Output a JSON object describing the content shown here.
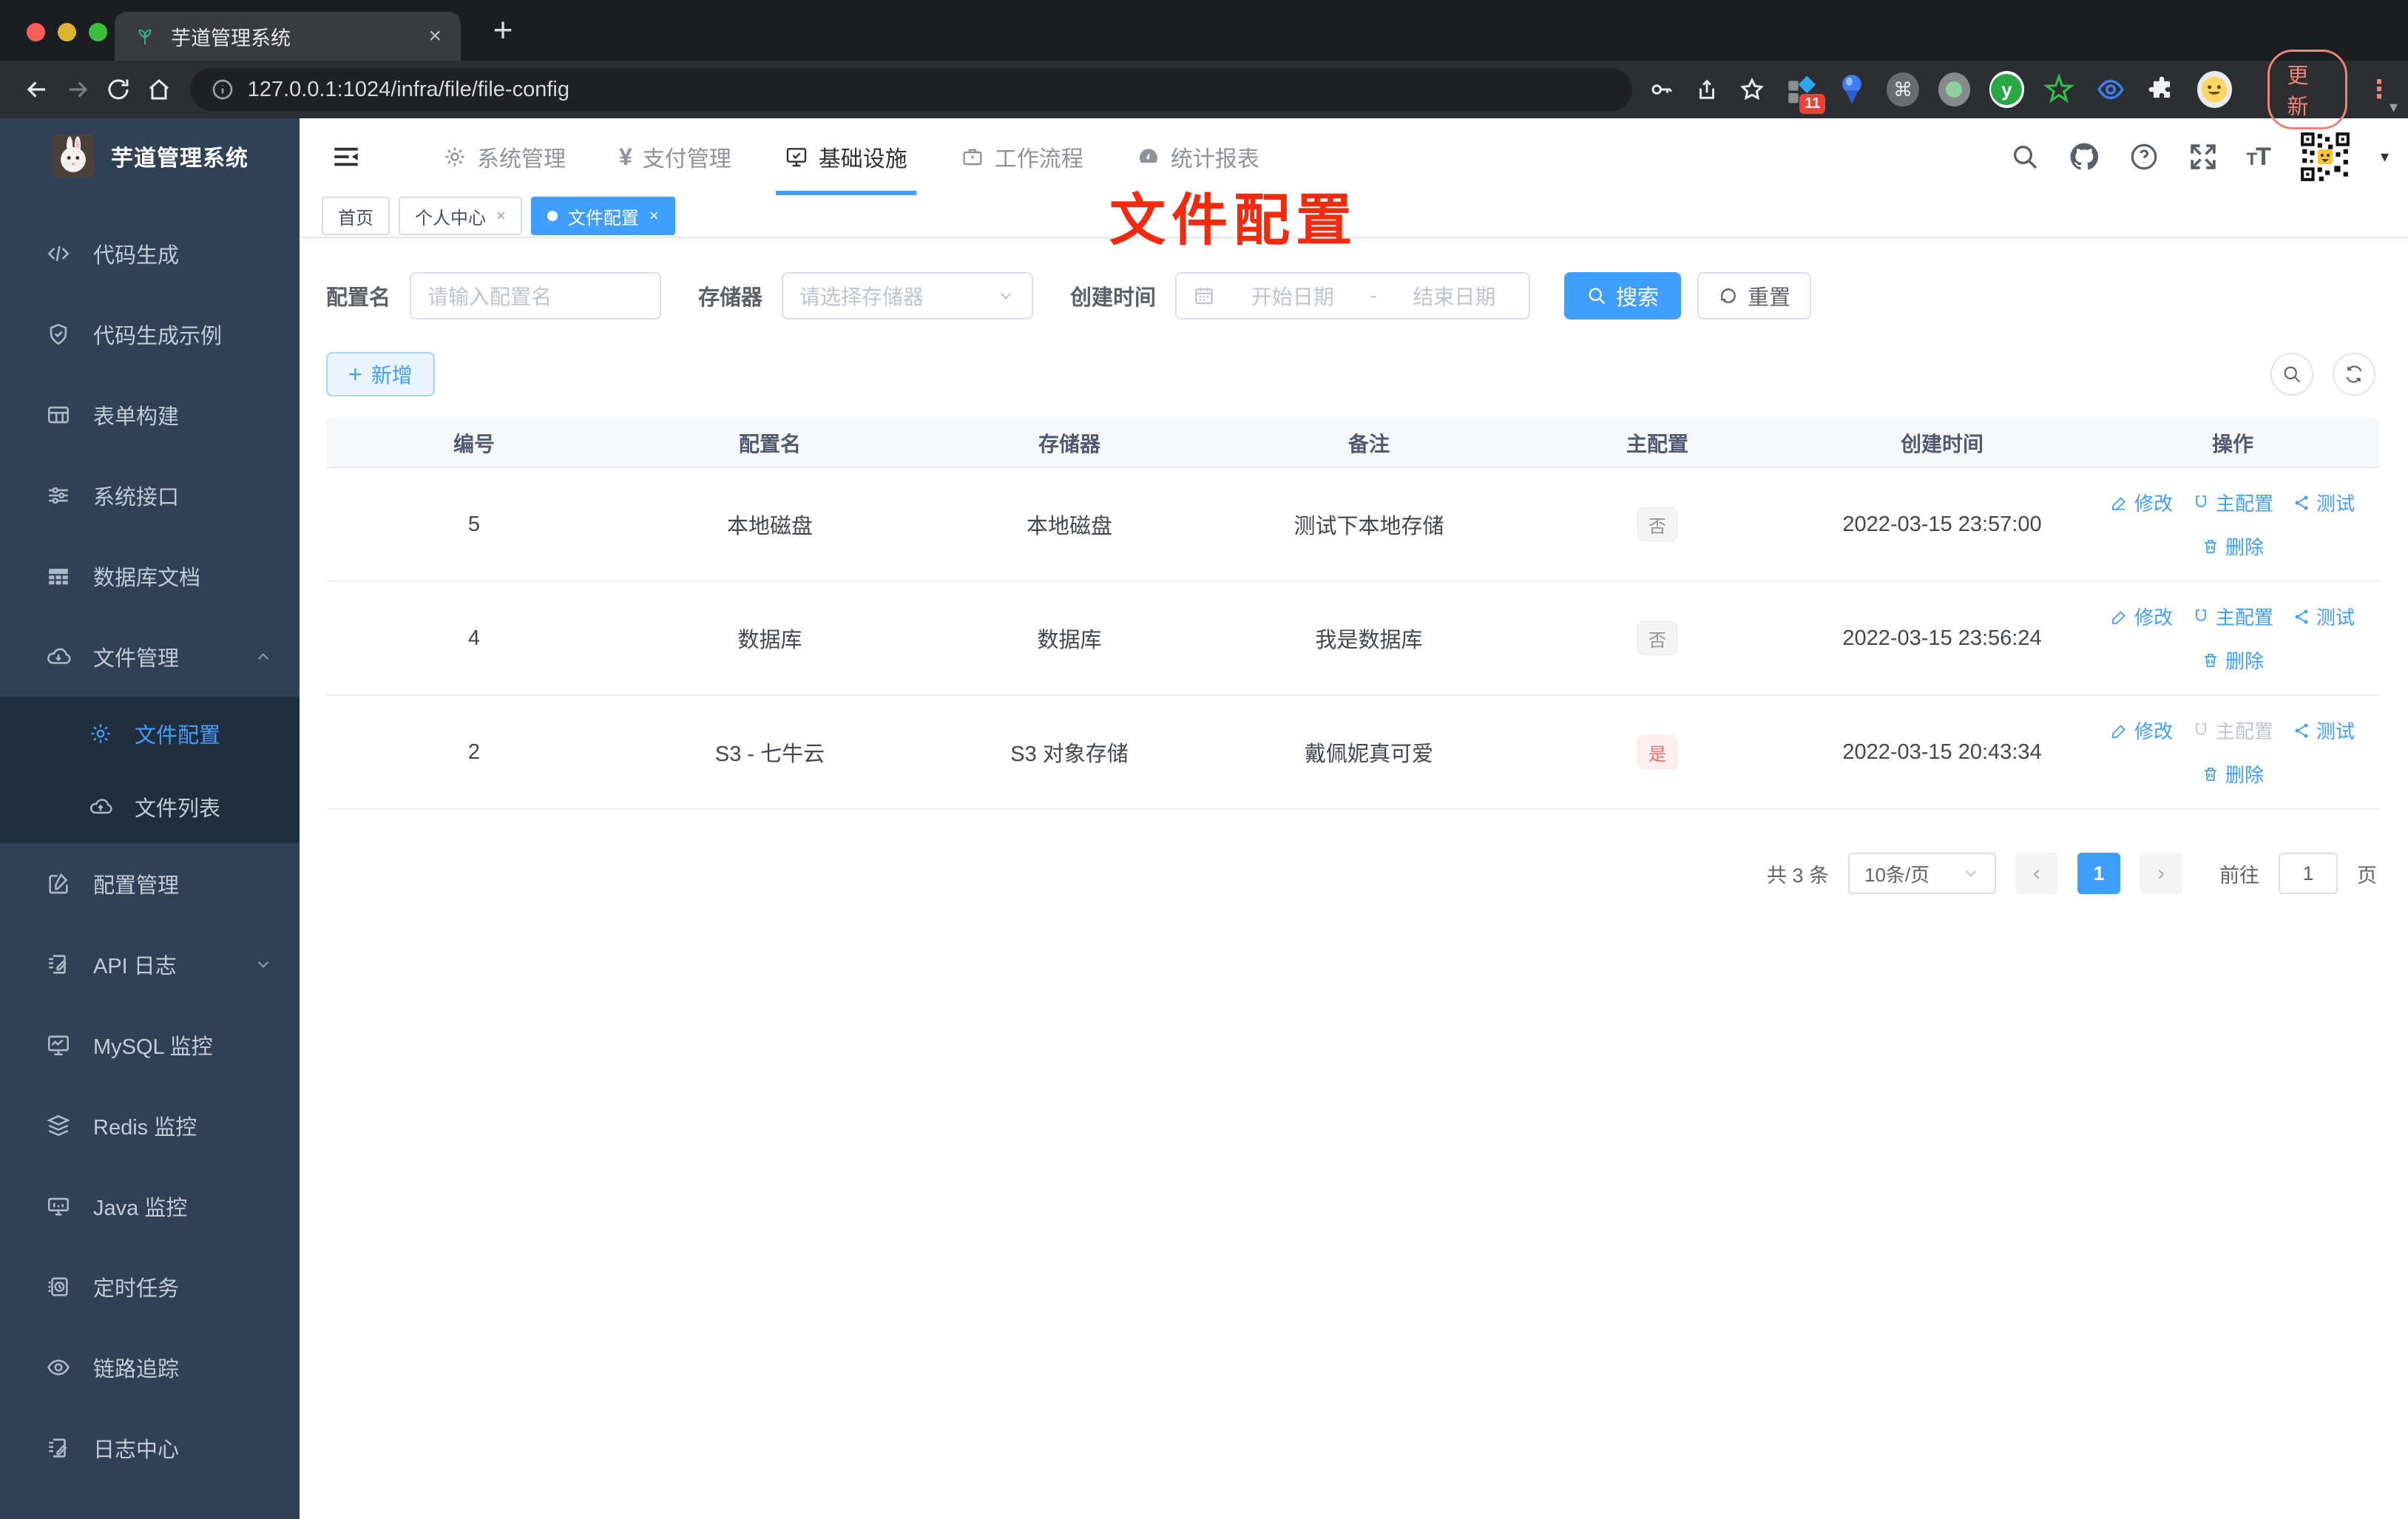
{
  "browser": {
    "tab_title": "芋道管理系统",
    "new_tab": "+",
    "close_tab": "×",
    "url": "127.0.0.1:1024/infra/file/file-config",
    "extension_badge": "11",
    "update_label": "更新",
    "kebab": "⋮"
  },
  "sidebar": {
    "title": "芋道管理系统",
    "items": [
      {
        "label": "代码生成"
      },
      {
        "label": "代码生成示例"
      },
      {
        "label": "表单构建"
      },
      {
        "label": "系统接口"
      },
      {
        "label": "数据库文档"
      },
      {
        "label": "文件管理"
      },
      {
        "label": "配置管理"
      },
      {
        "label": "API 日志"
      },
      {
        "label": "MySQL 监控"
      },
      {
        "label": "Redis 监控"
      },
      {
        "label": "Java 监控"
      },
      {
        "label": "定时任务"
      },
      {
        "label": "链路追踪"
      },
      {
        "label": "日志中心"
      }
    ],
    "file_children": [
      {
        "label": "文件配置"
      },
      {
        "label": "文件列表"
      }
    ]
  },
  "topnav": {
    "items": [
      {
        "label": "系统管理"
      },
      {
        "label": "支付管理"
      },
      {
        "label": "基础设施"
      },
      {
        "label": "工作流程"
      },
      {
        "label": "统计报表"
      }
    ]
  },
  "tags": {
    "home": "首页",
    "profile": "个人中心",
    "current": "文件配置",
    "close": "×"
  },
  "annotation": "文件配置",
  "filters": {
    "name_label": "配置名",
    "name_placeholder": "请输入配置名",
    "storage_label": "存储器",
    "storage_placeholder": "请选择存储器",
    "time_label": "创建时间",
    "start_placeholder": "开始日期",
    "range_separator": "-",
    "end_placeholder": "结束日期",
    "search_label": "搜索",
    "reset_label": "重置"
  },
  "toolbar": {
    "add_label": "新增"
  },
  "table": {
    "columns": [
      "编号",
      "配置名",
      "存储器",
      "备注",
      "主配置",
      "创建时间",
      "操作"
    ],
    "actions": {
      "edit": "修改",
      "master": "主配置",
      "test": "测试",
      "delete": "删除"
    },
    "rows": [
      {
        "id": "5",
        "name": "本地磁盘",
        "storage": "本地磁盘",
        "remark": "测试下本地存储",
        "master": "否",
        "created": "2022-03-15 23:57:00"
      },
      {
        "id": "4",
        "name": "数据库",
        "storage": "数据库",
        "remark": "我是数据库",
        "master": "否",
        "created": "2022-03-15 23:56:24"
      },
      {
        "id": "2",
        "name": "S3 - 七牛云",
        "storage": "S3 对象存储",
        "remark": "戴佩妮真可爱",
        "master": "是",
        "created": "2022-03-15 20:43:34"
      }
    ]
  },
  "pagination": {
    "total_text": "共 3 条",
    "page_size": "10条/页",
    "current_page": "1",
    "goto_label": "前往",
    "goto_value": "1",
    "page_unit": "页"
  },
  "colors": {
    "accent": "#409eff",
    "annotation_red": "#f5290b",
    "sidebar_bg": "#304156",
    "submenu_bg": "#1f2d3d",
    "tag_no_text": "#909399",
    "tag_yes_text": "#f56c6c"
  }
}
